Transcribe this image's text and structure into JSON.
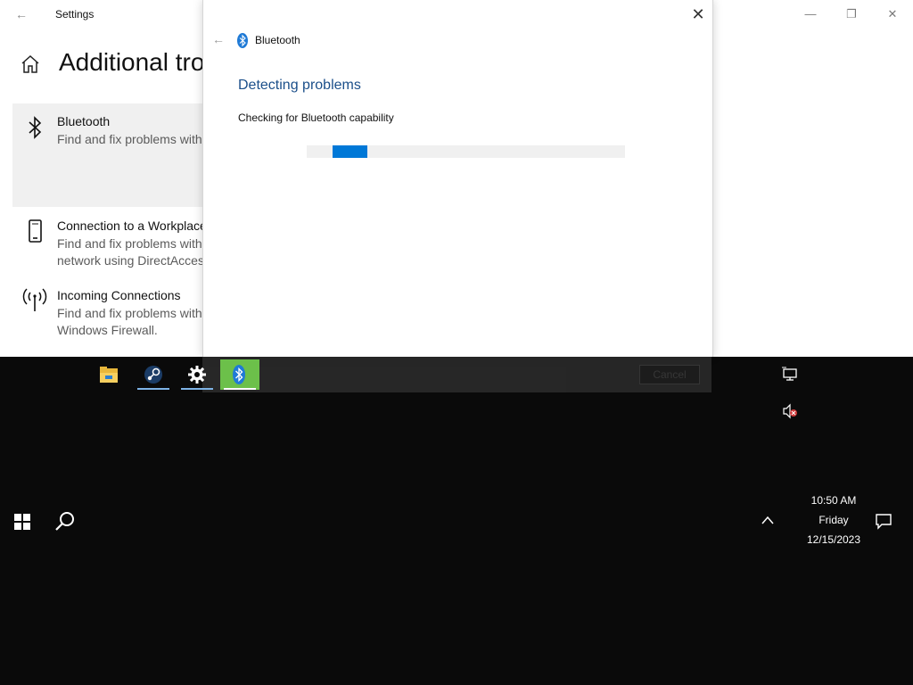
{
  "settings": {
    "title": "Settings",
    "page_title": "Additional tro",
    "items": [
      {
        "name": "Bluetooth",
        "desc1": "Find and fix problems with",
        "desc2": "",
        "selected": true
      },
      {
        "name": "Connection to a Workplace",
        "desc1": "Find and fix problems with",
        "desc2": "network using DirectAcces"
      },
      {
        "name": "Incoming Connections",
        "desc1": "Find and fix problems with",
        "desc2": "Windows Firewall."
      }
    ]
  },
  "dialog": {
    "app_name": "Bluetooth",
    "heading": "Detecting problems",
    "status": "Checking for Bluetooth capability",
    "progress_value": 0.11,
    "cancel_label": "Cancel"
  },
  "taskbar": {
    "apps": [
      {
        "icon": "file-explorer-icon"
      },
      {
        "icon": "steam-icon"
      },
      {
        "icon": "settings-gear-icon"
      },
      {
        "icon": "bluetooth-icon"
      }
    ],
    "clock": {
      "time": "10:50 AM",
      "day": "Friday",
      "date": "12/15/2023"
    }
  },
  "colors": {
    "accent": "#0078d7",
    "heading": "#1b4f8a",
    "active_app": "#6cc04a"
  }
}
